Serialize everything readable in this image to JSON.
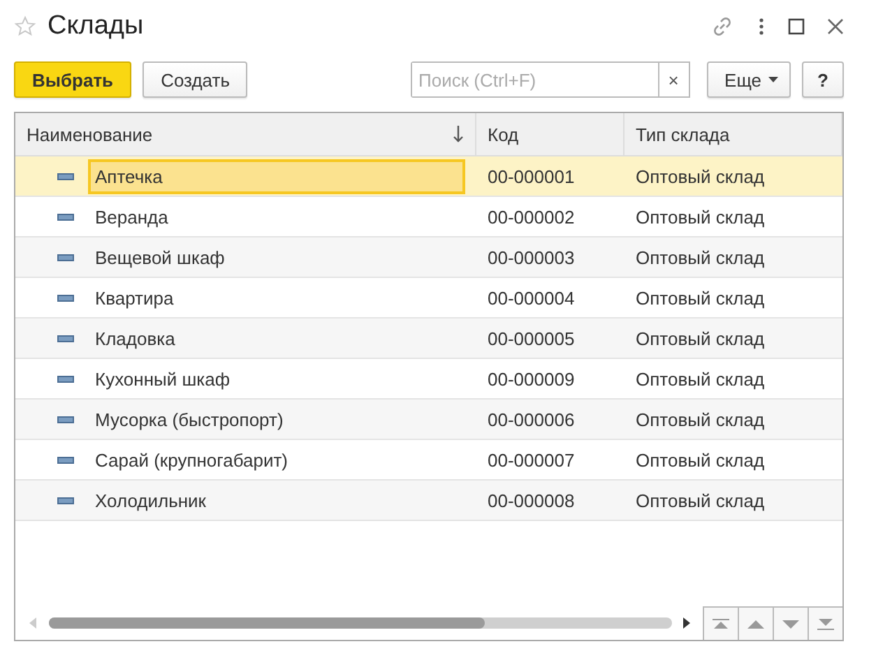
{
  "window": {
    "title": "Склады"
  },
  "toolbar": {
    "select_button": "Выбрать",
    "create_button": "Создать",
    "search": {
      "placeholder": "Поиск (Ctrl+F)"
    },
    "clear_button": "×",
    "more_button": "Еще",
    "help_button": "?"
  },
  "table": {
    "columns": [
      {
        "label": "Наименование",
        "sorted": true
      },
      {
        "label": "Код",
        "sorted": false
      },
      {
        "label": "Тип склада",
        "sorted": false
      }
    ],
    "rows": [
      {
        "name": "Аптечка",
        "code": "00-000001",
        "type": "Оптовый склад",
        "selected": true
      },
      {
        "name": "Веранда",
        "code": "00-000002",
        "type": "Оптовый склад",
        "selected": false
      },
      {
        "name": "Вещевой шкаф",
        "code": "00-000003",
        "type": "Оптовый склад",
        "selected": false
      },
      {
        "name": "Квартира",
        "code": "00-000004",
        "type": "Оптовый склад",
        "selected": false
      },
      {
        "name": "Кладовка",
        "code": "00-000005",
        "type": "Оптовый склад",
        "selected": false
      },
      {
        "name": "Кухонный шкаф",
        "code": "00-000009",
        "type": "Оптовый склад",
        "selected": false
      },
      {
        "name": "Мусорка (быстропорт)",
        "code": "00-000006",
        "type": "Оптовый склад",
        "selected": false
      },
      {
        "name": "Сарай (крупногабарит)",
        "code": "00-000007",
        "type": "Оптовый склад",
        "selected": false
      },
      {
        "name": "Холодильник",
        "code": "00-000008",
        "type": "Оптовый склад",
        "selected": false
      }
    ]
  }
}
